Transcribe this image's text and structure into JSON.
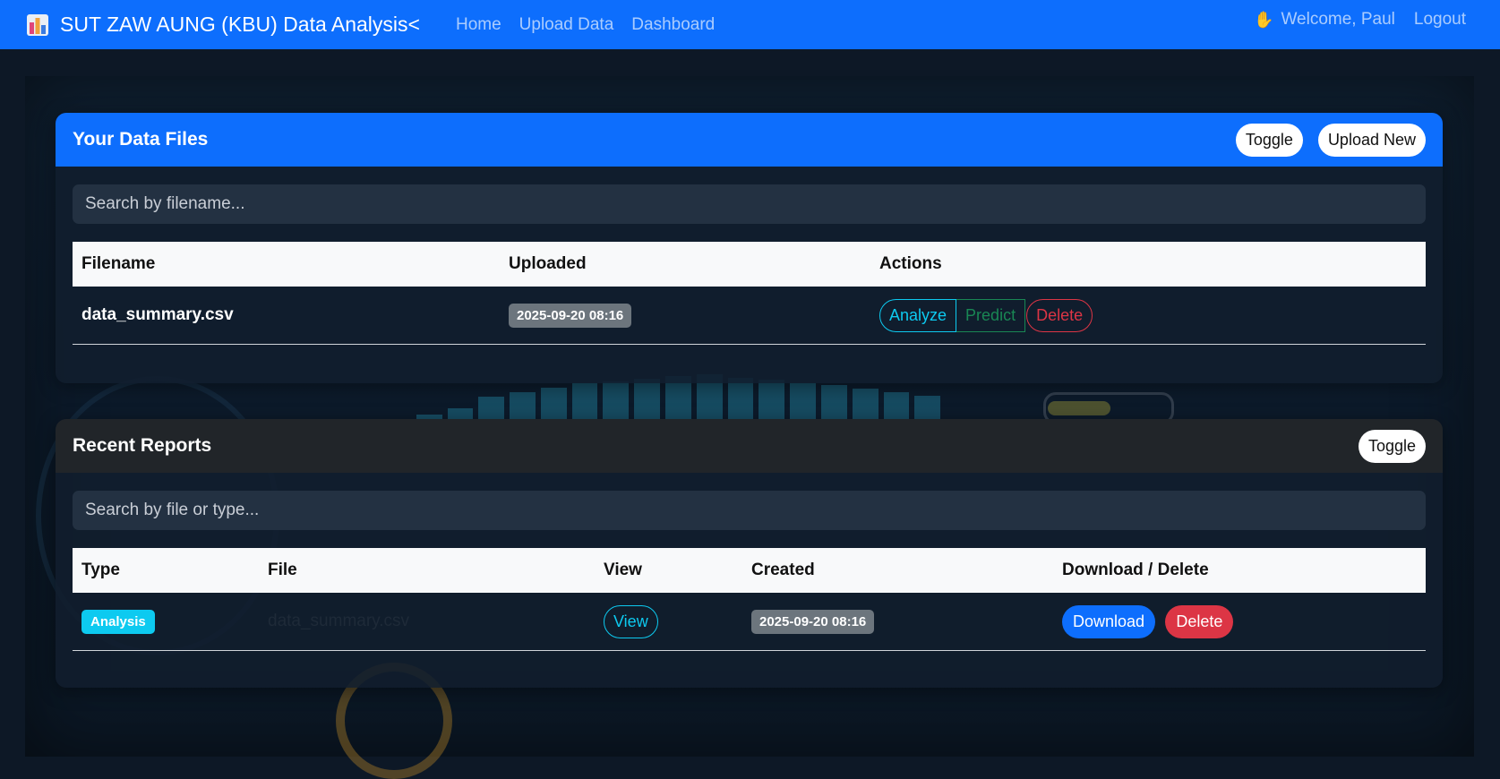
{
  "navbar": {
    "brand_text": "SUT ZAW AUNG (KBU) Data Analysis<",
    "brand_icon": "bar-chart-icon",
    "links": [
      "Home",
      "Upload Data",
      "Dashboard"
    ],
    "welcome_icon": "waving-hand-icon",
    "welcome_text": "Welcome, Paul",
    "logout_label": "Logout"
  },
  "files_card": {
    "title": "Your Data Files",
    "toggle_label": "Toggle",
    "upload_label": "Upload New",
    "search_placeholder": "Search by filename...",
    "columns": [
      "Filename",
      "Uploaded",
      "Actions"
    ],
    "rows": [
      {
        "filename": "data_summary.csv",
        "uploaded": "2025-09-20 08:16",
        "actions": {
          "analyze": "Analyze",
          "predict": "Predict",
          "delete": "Delete"
        }
      }
    ]
  },
  "reports_card": {
    "title": "Recent Reports",
    "toggle_label": "Toggle",
    "search_placeholder": "Search by file or type...",
    "columns": [
      "Type",
      "File",
      "View",
      "Created",
      "Download / Delete"
    ],
    "rows": [
      {
        "type": "Analysis",
        "file": "data_summary.csv",
        "view": "View",
        "created": "2025-09-20 08:16",
        "download": "Download",
        "delete": "Delete"
      }
    ]
  },
  "colors": {
    "primary": "#0d6efd",
    "info": "#0dcaf0",
    "success": "#198754",
    "danger": "#dc3545",
    "secondary": "#6c757d",
    "dark_header": "#212529"
  }
}
